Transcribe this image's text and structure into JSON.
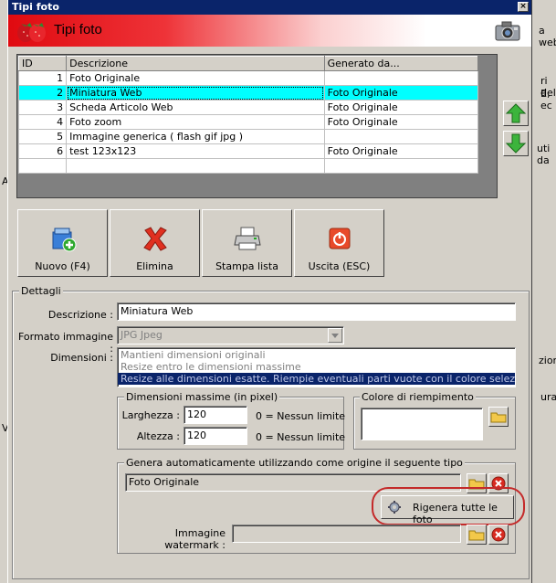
{
  "window": {
    "title": "Tipi foto",
    "header_title": "Tipi foto",
    "close_glyph": "×"
  },
  "background_fragments": [
    "a web",
    "ri del",
    "E, ec",
    "uti da",
    "zione",
    "ura",
    "A",
    "V"
  ],
  "grid": {
    "columns": [
      "ID",
      "Descrizione",
      "Generato da..."
    ],
    "rows": [
      {
        "id": "1",
        "descrizione": "Foto Originale",
        "generato": ""
      },
      {
        "id": "2",
        "descrizione": "Miniatura Web",
        "generato": "Foto Originale"
      },
      {
        "id": "3",
        "descrizione": "Scheda Articolo Web",
        "generato": "Foto Originale"
      },
      {
        "id": "4",
        "descrizione": "Foto zoom",
        "generato": "Foto Originale"
      },
      {
        "id": "5",
        "descrizione": "Immagine generica ( flash gif jpg )",
        "generato": ""
      },
      {
        "id": "6",
        "descrizione": "test 123x123",
        "generato": "Foto Originale"
      }
    ],
    "selected_row": 2
  },
  "toolbar": {
    "nuovo": "Nuovo (F4)",
    "elimina": "Elimina",
    "stampa": "Stampa lista",
    "uscita": "Uscita (ESC)"
  },
  "details": {
    "group_label": "Dettagli",
    "descrizione_label": "Descrizione :",
    "descrizione_value": "Miniatura Web",
    "formato_label": "Formato immagine :",
    "formato_value": "JPG Jpeg",
    "dimensioni_label": "Dimensioni :",
    "dimensioni_options": [
      "Mantieni dimensioni originali",
      "Resize entro le dimensioni massime",
      "Resize alle dimensioni esatte. Riempie eventuali parti vuote con il colore selezionato."
    ],
    "dimensioni_selected": 2,
    "max_group_label": "Dimensioni massime (in pixel)",
    "larghezza_label": "Larghezza :",
    "larghezza_value": "120",
    "altezza_label": "Altezza :",
    "altezza_value": "120",
    "nessun_limite": "0 = Nessun limite",
    "colore_group_label": "Colore di riempimento",
    "genera_group_label": "Genera automaticamente utilizzando come origine il seguente tipo",
    "origine_value": "Foto Originale",
    "rigenera_label": "Rigenera tutte le foto",
    "watermark_label": "Immagine watermark :",
    "watermark_value": ""
  },
  "colors": {
    "selection": "#00ffff",
    "title_bar": "#0a246a",
    "highlight_ring": "#c42a2a"
  }
}
